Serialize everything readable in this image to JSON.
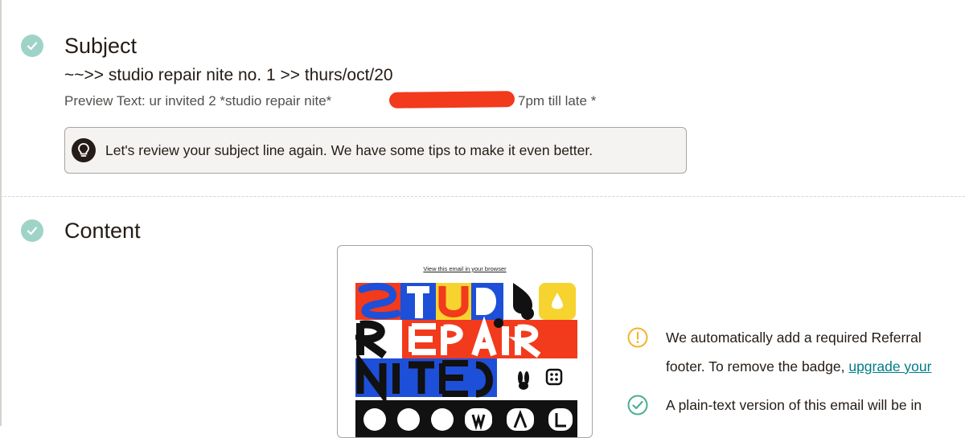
{
  "subject_section": {
    "title": "Subject",
    "subject_line": "~~>> studio repair nite no. 1 >> thurs/oct/20",
    "preview_label": "Preview Text: ur invited 2 *studio repair nite*",
    "preview_tail": "7pm till late *",
    "tip_text": "Let's review your subject line again. We have some tips to make it even better."
  },
  "content_section": {
    "title": "Content",
    "email_preview": {
      "view_in_browser": "View this email in your browser"
    },
    "notices": [
      {
        "status": "warning",
        "line1": "We automatically add a required Referral",
        "line2_prefix": "footer. To remove the badge,",
        "line2_link": "upgrade your"
      },
      {
        "status": "success",
        "line1": "A plain-text version of this email will be in"
      }
    ]
  },
  "colors": {
    "success": "#9fd3c7",
    "warning": "#f0b52e",
    "link": "#007c89",
    "redaction": "#f23a1c"
  },
  "icons": [
    "check-circle-icon",
    "lightbulb-icon",
    "warning-circle-icon",
    "check-outline-icon"
  ]
}
